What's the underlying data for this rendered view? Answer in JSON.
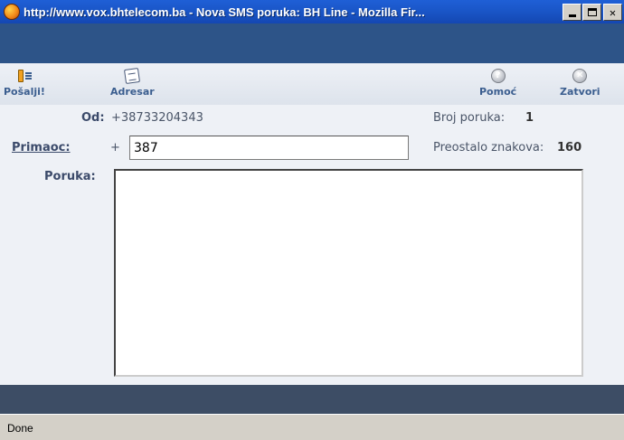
{
  "window": {
    "title": "http://www.vox.bhtelecom.ba - Nova SMS poruka: BH Line - Mozilla Fir..."
  },
  "toolbar": {
    "send_label": "Pošalji!",
    "addressbook_label": "Adresar",
    "help_label": "Pomoć",
    "close_label": "Zatvori"
  },
  "form": {
    "from_label": "Od:",
    "from_value": "+38733204343",
    "count_label": "Broj poruka:",
    "count_value": "1",
    "to_label": "Primaoc:",
    "to_prefix": "+",
    "to_value": "387",
    "remaining_label": "Preostalo znakova:",
    "remaining_value": "160",
    "message_label": "Poruka:",
    "message_value": ""
  },
  "statusbar": {
    "text": "Done"
  },
  "colors": {
    "titlebar": "#1a56c8",
    "header_band": "#2d5488",
    "toolbar_text": "#3b5e8f",
    "form_bg": "#eef1f6",
    "footer_band": "#3d4d65"
  }
}
